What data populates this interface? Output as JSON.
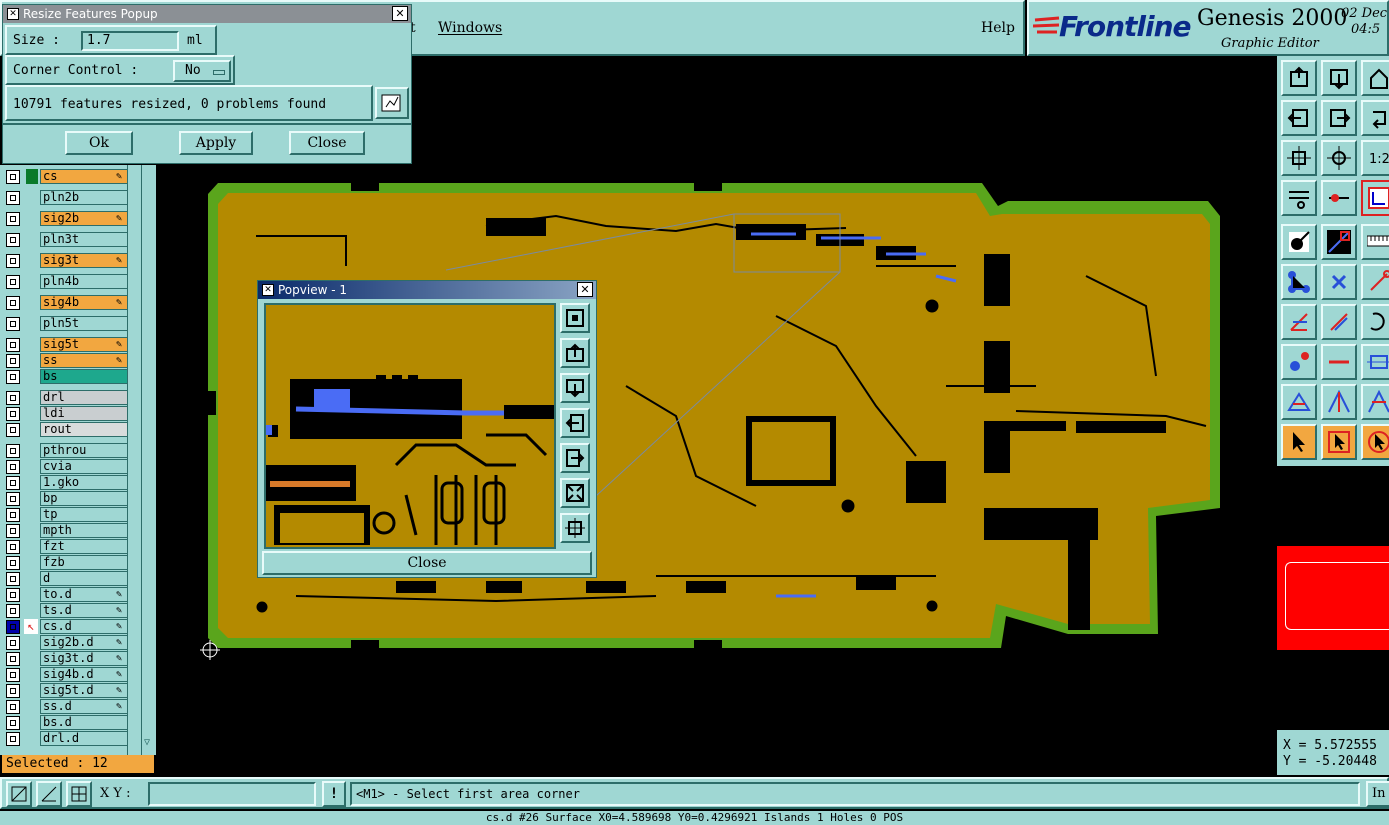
{
  "menubar": {
    "item_partial": "t",
    "windows": "Windows",
    "help": "Help"
  },
  "brand": {
    "logo": "Frontline",
    "product": "Genesis 2000",
    "subtitle": "Graphic Editor",
    "date_top": "02 Dec",
    "date_bottom": "04:5"
  },
  "resize_popup": {
    "title": "Resize Features Popup",
    "size_label": "Size :",
    "size_value": "1.7",
    "size_unit": "ml",
    "corner_label": "Corner Control :",
    "corner_value": "No",
    "status": "10791 features resized, 0 problems found",
    "ok": "Ok",
    "apply": "Apply",
    "close": "Close"
  },
  "popview": {
    "title": "Popview - 1",
    "close": "Close"
  },
  "layers": [
    {
      "name": "cs",
      "style": "o",
      "pen": true
    },
    {
      "name": "pln2b",
      "style": "",
      "pen": false
    },
    {
      "name": "sig2b",
      "style": "o",
      "pen": true
    },
    {
      "name": "pln3t",
      "style": "",
      "pen": false
    },
    {
      "name": "sig3t",
      "style": "o",
      "pen": true
    },
    {
      "name": "pln4b",
      "style": "",
      "pen": false
    },
    {
      "name": "sig4b",
      "style": "o",
      "pen": true
    },
    {
      "name": "pln5t",
      "style": "",
      "pen": false
    },
    {
      "name": "sig5t",
      "style": "o",
      "pen": true
    },
    {
      "name": "ss",
      "style": "o",
      "pen": true
    },
    {
      "name": "bs",
      "style": "g",
      "pen": false
    },
    {
      "name": "drl",
      "style": "gr",
      "pen": false
    },
    {
      "name": "ldi",
      "style": "gr",
      "pen": false
    },
    {
      "name": "rout",
      "style": "wh",
      "pen": false
    },
    {
      "name": "pthrou",
      "style": "",
      "pen": false
    },
    {
      "name": "cvia",
      "style": "",
      "pen": false
    },
    {
      "name": "1.gko",
      "style": "",
      "pen": false
    },
    {
      "name": "bp",
      "style": "",
      "pen": false
    },
    {
      "name": "tp",
      "style": "",
      "pen": false
    },
    {
      "name": "mpth",
      "style": "",
      "pen": false
    },
    {
      "name": "fzt",
      "style": "",
      "pen": false
    },
    {
      "name": "fzb",
      "style": "",
      "pen": false
    },
    {
      "name": "d",
      "style": "",
      "pen": false
    },
    {
      "name": "to.d",
      "style": "",
      "pen": true
    },
    {
      "name": "ts.d",
      "style": "",
      "pen": true
    },
    {
      "name": "cs.d",
      "style": "",
      "pen": true
    },
    {
      "name": "sig2b.d",
      "style": "",
      "pen": true
    },
    {
      "name": "sig3t.d",
      "style": "",
      "pen": true
    },
    {
      "name": "sig4b.d",
      "style": "",
      "pen": true
    },
    {
      "name": "sig5t.d",
      "style": "",
      "pen": true
    },
    {
      "name": "ss.d",
      "style": "",
      "pen": true
    },
    {
      "name": "bs.d",
      "style": "",
      "pen": false
    },
    {
      "name": "drl.d",
      "style": "",
      "pen": false
    }
  ],
  "selected_text": "Selected : 12",
  "bottom": {
    "xy_label": "X Y :",
    "xy_value": "",
    "prompt": "<M1> - Select first area corner",
    "right_button": "In",
    "info_line": "cs.d #26 Surface X0=4.589698 Y0=0.4296921 Islands 1 Holes 0 POS"
  },
  "coords": {
    "x": "X = 5.572555",
    "y": "Y = -5.20448"
  },
  "colors": {
    "teal": "#9fd7d3",
    "board": "#b48a00",
    "border_green": "#5aa51c",
    "orange": "#f2a740",
    "highlight_red": "#ff0000"
  }
}
